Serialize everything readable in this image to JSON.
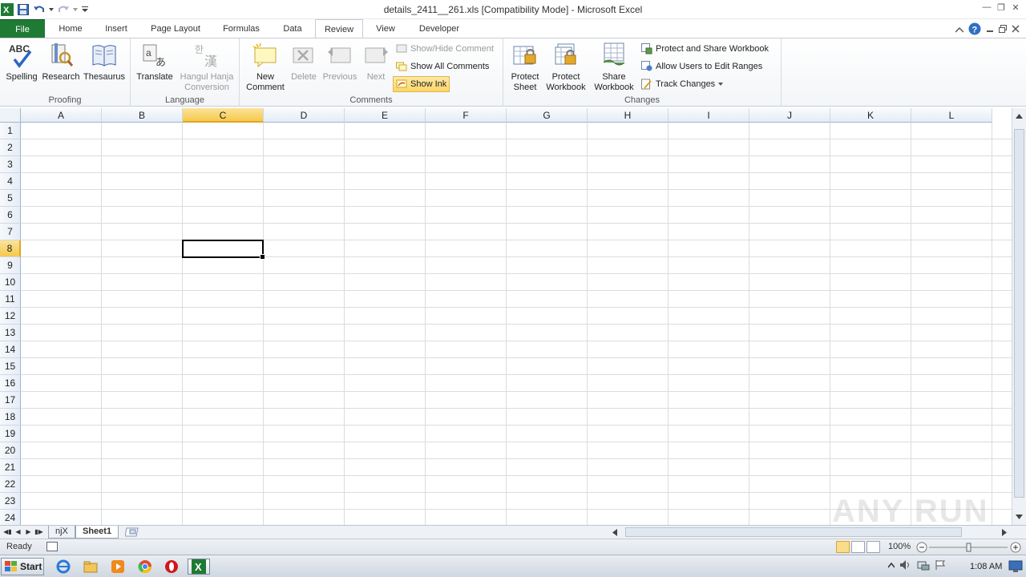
{
  "window": {
    "title": "details_2411__261.xls  [Compatibility Mode]  -  Microsoft Excel",
    "app_icon": "excel-icon"
  },
  "tabs": [
    {
      "label": "File",
      "key": "file"
    },
    {
      "label": "Home",
      "key": "home"
    },
    {
      "label": "Insert",
      "key": "insert"
    },
    {
      "label": "Page Layout",
      "key": "page-layout"
    },
    {
      "label": "Formulas",
      "key": "formulas"
    },
    {
      "label": "Data",
      "key": "data"
    },
    {
      "label": "Review",
      "key": "review",
      "active": true
    },
    {
      "label": "View",
      "key": "view"
    },
    {
      "label": "Developer",
      "key": "developer"
    }
  ],
  "ribbon": {
    "proofing": {
      "label": "Proofing",
      "spelling": "Spelling",
      "research": "Research",
      "thesaurus": "Thesaurus"
    },
    "language": {
      "label": "Language",
      "translate": "Translate",
      "hangul_line1": "Hangul Hanja",
      "hangul_line2": "Conversion"
    },
    "comments": {
      "label": "Comments",
      "new_line1": "New",
      "new_line2": "Comment",
      "delete": "Delete",
      "previous": "Previous",
      "next": "Next",
      "show_hide": "Show/Hide Comment",
      "show_all": "Show All Comments",
      "show_ink": "Show Ink"
    },
    "changes": {
      "label": "Changes",
      "protect_sheet_line1": "Protect",
      "protect_sheet_line2": "Sheet",
      "protect_wb_line1": "Protect",
      "protect_wb_line2": "Workbook",
      "share_wb_line1": "Share",
      "share_wb_line2": "Workbook",
      "protect_share": "Protect and Share Workbook",
      "allow_users": "Allow Users to Edit Ranges",
      "track_changes": "Track Changes"
    }
  },
  "grid": {
    "columns": [
      "A",
      "B",
      "C",
      "D",
      "E",
      "F",
      "G",
      "H",
      "I",
      "J",
      "K",
      "L"
    ],
    "rows": [
      "1",
      "2",
      "3",
      "4",
      "5",
      "6",
      "7",
      "8",
      "9",
      "10",
      "11",
      "12",
      "13",
      "14",
      "15",
      "16",
      "17",
      "18",
      "19",
      "20",
      "21",
      "22",
      "23",
      "24"
    ],
    "selected_col": "C",
    "selected_row": "8"
  },
  "sheets": [
    {
      "name": "njX",
      "active": false
    },
    {
      "name": "Sheet1",
      "active": true
    }
  ],
  "status": {
    "ready": "Ready",
    "zoom": "100%"
  },
  "taskbar": {
    "start": "Start",
    "time": "1:08 AM"
  },
  "watermark": "ANY RUN",
  "colors": {
    "file_tab": "#1f7a34",
    "selected_header": "#f5c94a",
    "gridline": "#dadcdd"
  }
}
